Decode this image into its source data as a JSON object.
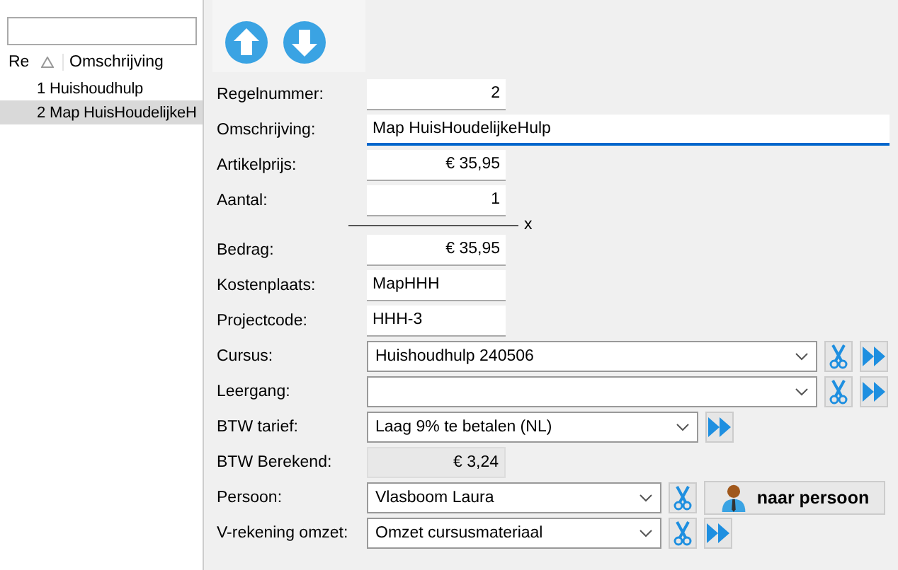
{
  "list": {
    "columns": [
      {
        "label": "Re",
        "sorted": true
      },
      {
        "label": "Omschrijving",
        "sorted": false
      }
    ],
    "rows": [
      {
        "nr": "1",
        "text": "Huishoudhulp",
        "selected": false
      },
      {
        "nr": "2",
        "text": "Map HuisHoudelijkeH",
        "selected": true
      }
    ]
  },
  "form": {
    "fields": [
      {
        "label": "Regelnummer:",
        "kind": "amount",
        "value": "2"
      },
      {
        "label": "Omschrijving:",
        "kind": "text",
        "value": "Map HuisHoudelijkeHulp",
        "focused": true
      },
      {
        "label": "Artikelprijs:",
        "kind": "amount",
        "value": "€ 35,95"
      },
      {
        "label": "Aantal:",
        "kind": "amount",
        "value": "1"
      },
      {
        "kind": "multiply",
        "value": "x"
      },
      {
        "label": "Bedrag:",
        "kind": "amount",
        "value": "€ 35,95"
      },
      {
        "label": "Kostenplaats:",
        "kind": "code",
        "value": "MapHHH"
      },
      {
        "label": "Projectcode:",
        "kind": "code",
        "value": "HHH-3"
      },
      {
        "label": "Cursus:",
        "kind": "widecombo",
        "value": "Huishoudhulp 240506",
        "actions": [
          {
            "kind": "clear"
          },
          {
            "kind": "forward"
          }
        ]
      },
      {
        "label": "Leergang:",
        "kind": "widecombo",
        "actions": [
          {
            "kind": "clear"
          },
          {
            "kind": "forward"
          }
        ]
      },
      {
        "label": "BTW tarief:",
        "kind": "combo",
        "value": "Laag 9% te betalen (NL)",
        "actions": [
          {
            "kind": "forward"
          }
        ]
      },
      {
        "label": "BTW Berekend:",
        "kind": "readonly",
        "value": "€ 3,24"
      },
      {
        "label": "Persoon:",
        "kind": "narrowcombo",
        "value": "Vlasboom Laura",
        "actions": [
          {
            "kind": "clear"
          },
          {
            "kind": "person",
            "text": "naar persoon"
          }
        ]
      },
      {
        "label": "V-rekening omzet:",
        "kind": "narrowcombo",
        "value": "Omzet cursusmateriaal",
        "actions": [
          {
            "kind": "clear"
          },
          {
            "kind": "forward"
          }
        ]
      }
    ]
  }
}
